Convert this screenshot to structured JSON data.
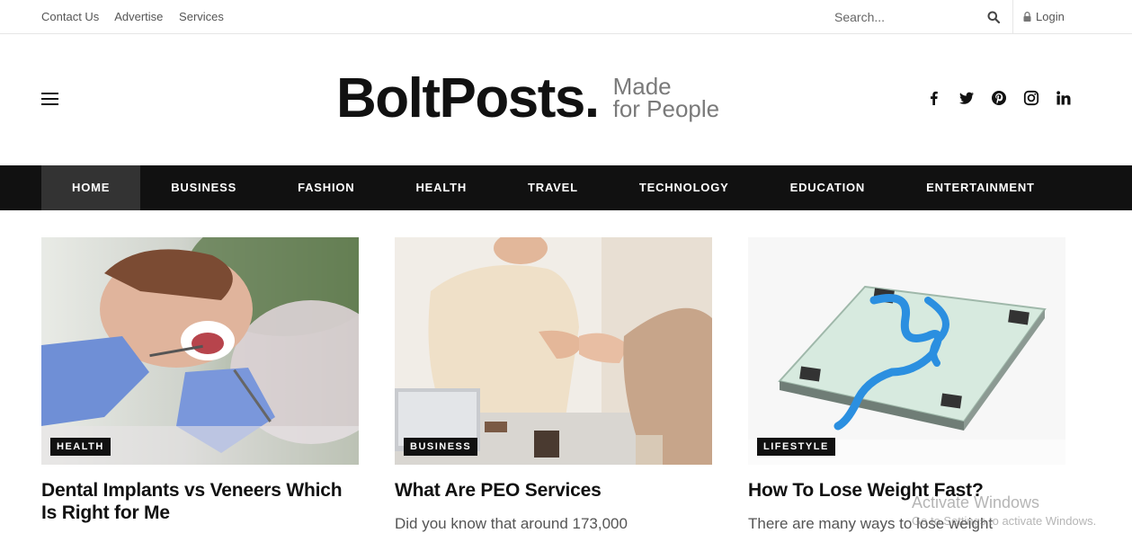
{
  "topbar": {
    "links": [
      "Contact Us",
      "Advertise",
      "Services"
    ],
    "search_placeholder": "Search...",
    "login_label": "Login"
  },
  "header": {
    "logo_main": "BoltPosts.",
    "tagline_line1": "Made",
    "tagline_line2": "for People",
    "social_icons": [
      "facebook-icon",
      "twitter-icon",
      "pinterest-icon",
      "instagram-icon",
      "linkedin-icon"
    ]
  },
  "nav": {
    "items": [
      "HOME",
      "BUSINESS",
      "FASHION",
      "HEALTH",
      "TRAVEL",
      "TECHNOLOGY",
      "EDUCATION",
      "ENTERTAINMENT"
    ],
    "active": "HOME"
  },
  "cards": [
    {
      "category": "HEALTH",
      "title": "Dental Implants vs Veneers Which Is Right for Me",
      "excerpt": ""
    },
    {
      "category": "BUSINESS",
      "title": "What Are PEO Services",
      "excerpt": "Did you know that around 173,000"
    },
    {
      "category": "LIFESTYLE",
      "title": "How To Lose Weight Fast?",
      "excerpt": "There are many ways to lose weight"
    }
  ],
  "watermark": {
    "line1": "Activate Windows",
    "line2": "Go to Settings to activate Windows."
  },
  "colors": {
    "nav_bg": "#111111",
    "nav_active": "#333333",
    "badge_bg": "#111111",
    "tagline": "#7a7a7a"
  }
}
